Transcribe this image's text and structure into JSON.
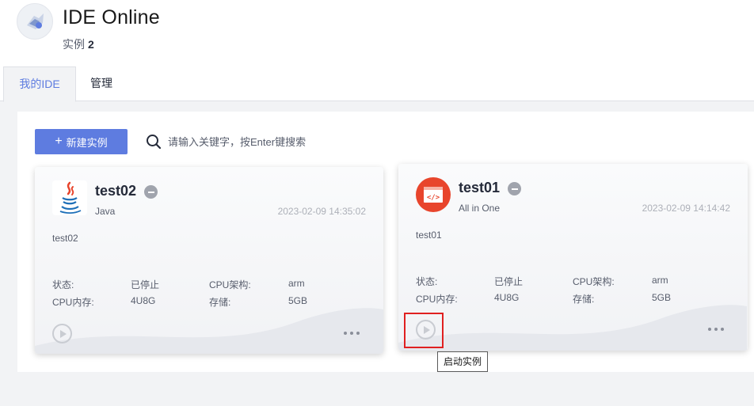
{
  "header": {
    "title": "IDE Online",
    "instance_label": "实例",
    "instance_count": "2"
  },
  "tabs": [
    {
      "label": "我的IDE",
      "active": true
    },
    {
      "label": "管理",
      "active": false
    }
  ],
  "toolbar": {
    "new_instance_label": "新建实例",
    "search_placeholder": "请输入关键字，按Enter键搜索"
  },
  "cards": [
    {
      "name": "test02",
      "type": "Java",
      "created": "2023-02-09 14:35:02",
      "description": "test02",
      "status_label": "状态:",
      "status_value": "已停止",
      "arch_label": "CPU架构:",
      "arch_value": "arm",
      "spec_label": "CPU内存:",
      "spec_value": "4U8G",
      "storage_label": "存储:",
      "storage_value": "5GB"
    },
    {
      "name": "test01",
      "type": "All in One",
      "created": "2023-02-09 14:14:42",
      "description": "test01",
      "status_label": "状态:",
      "status_value": "已停止",
      "arch_label": "CPU架构:",
      "arch_value": "arm",
      "spec_label": "CPU内存:",
      "spec_value": "4U8G",
      "storage_label": "存储:",
      "storage_value": "5GB"
    }
  ],
  "tooltip": {
    "text": "启动实例"
  },
  "colors": {
    "primary": "#5e7ce0",
    "highlight": "#e02020",
    "stopped": "#a0a4ad"
  }
}
